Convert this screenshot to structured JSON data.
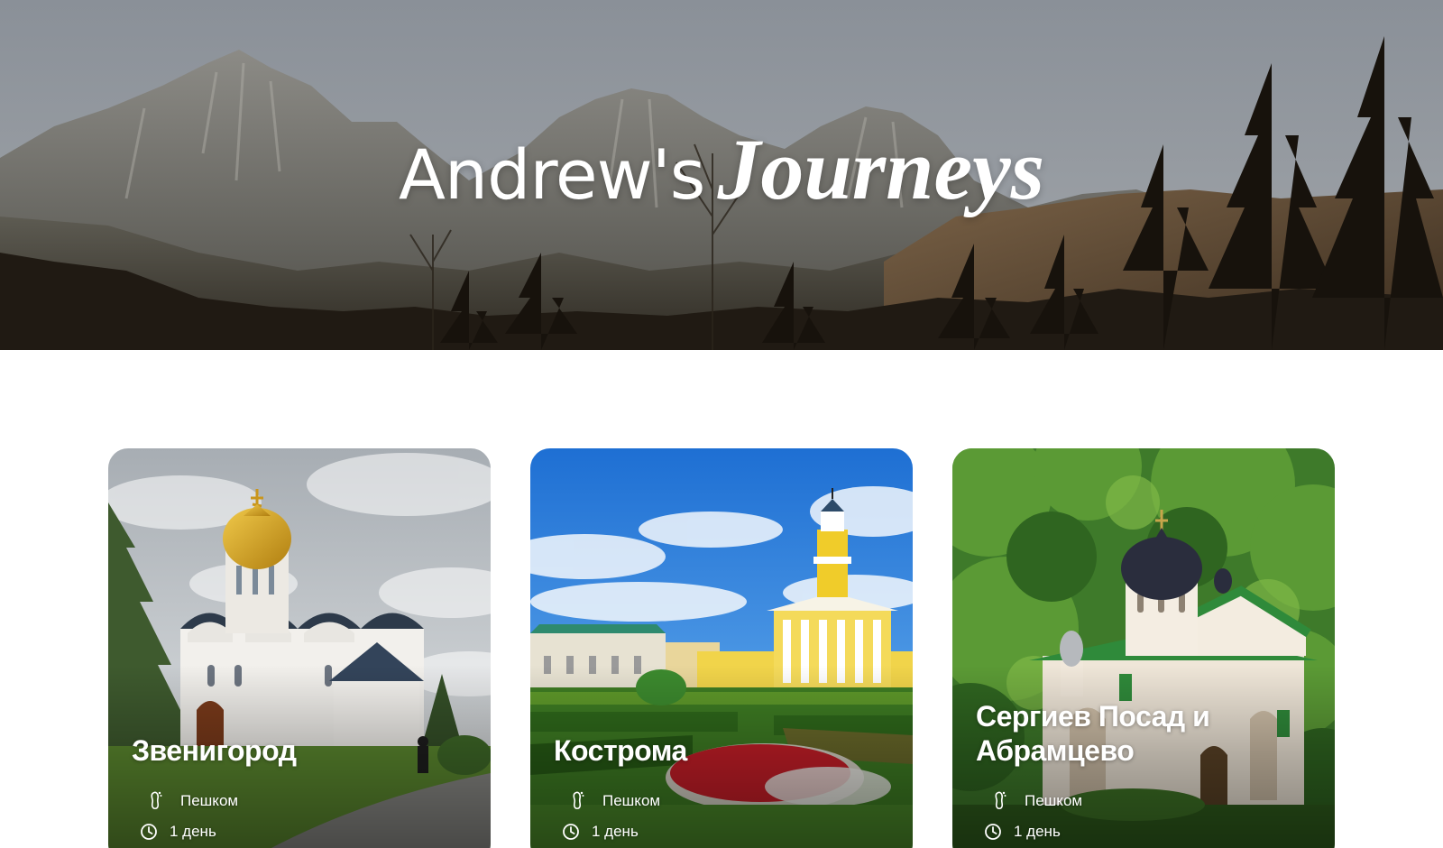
{
  "hero": {
    "title_main": "Andrew's",
    "title_accent": "Journeys"
  },
  "cards": [
    {
      "title": "Звенигород",
      "mode_icon": "footprint-icon",
      "mode": "Пешком",
      "duration_icon": "clock-icon",
      "duration": "1 день"
    },
    {
      "title": "Кострома",
      "mode_icon": "footprint-icon",
      "mode": "Пешком",
      "duration_icon": "clock-icon",
      "duration": "1 день"
    },
    {
      "title": "Сергиев Посад и Абрамцево",
      "mode_icon": "footprint-icon",
      "mode": "Пешком",
      "duration_icon": "clock-icon",
      "duration": "1 день"
    }
  ],
  "colors": {
    "sky_grey": "#8e959d",
    "mountain": "#6f6f6c",
    "forest_dark": "#1f1a14",
    "gold_dome": "#d4a21c",
    "blue_sky": "#2f7fd8",
    "green_foliage": "#4f8f2e",
    "text_white": "#ffffff"
  }
}
